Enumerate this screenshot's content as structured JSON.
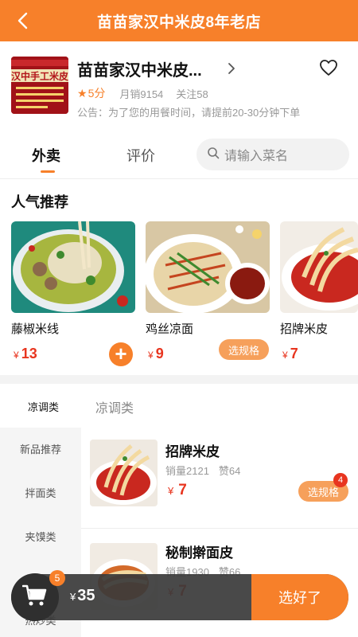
{
  "header": {
    "title": "苗苗家汉中米皮8年老店"
  },
  "shop": {
    "name": "苗苗家汉中米皮...",
    "logo_text": "汉中手工米皮",
    "score": "5分",
    "monthly_sales": "月销9154",
    "followers": "关注58",
    "notice": "公告：为了您的用餐时间，请提前20-30分钟下单"
  },
  "tabs": [
    {
      "label": "外卖",
      "active": true
    },
    {
      "label": "评价",
      "active": false
    }
  ],
  "search": {
    "placeholder": "请输入菜名"
  },
  "popular": {
    "title": "人气推荐",
    "items": [
      {
        "name": "藤椒米线",
        "currency": "¥",
        "price": "13",
        "action": "add"
      },
      {
        "name": "鸡丝凉面",
        "currency": "¥",
        "price": "9",
        "action": "spec",
        "action_label": "选规格"
      },
      {
        "name": "招牌米皮",
        "currency": "¥",
        "price": "7",
        "action": "none"
      }
    ]
  },
  "category_header": {
    "current": "凉调类",
    "section_title": "凉调类"
  },
  "sidebar": {
    "items": [
      "新品推荐",
      "拌面类",
      "夹馍类",
      "凉调类",
      "热炒类"
    ]
  },
  "foods": [
    {
      "name": "招牌米皮",
      "sales": "销量2121",
      "likes": "赞64",
      "currency": "¥",
      "price": "7",
      "spec_label": "选规格",
      "badge": "4"
    },
    {
      "name": "秘制擀面皮",
      "sales": "销量1930",
      "likes": "赞66",
      "currency": "¥",
      "price": "7"
    }
  ],
  "cart": {
    "count": "5",
    "currency": "¥",
    "total": "35",
    "submit_label": "选好了"
  },
  "colors": {
    "accent": "#f7802a",
    "price": "#e8351f"
  }
}
